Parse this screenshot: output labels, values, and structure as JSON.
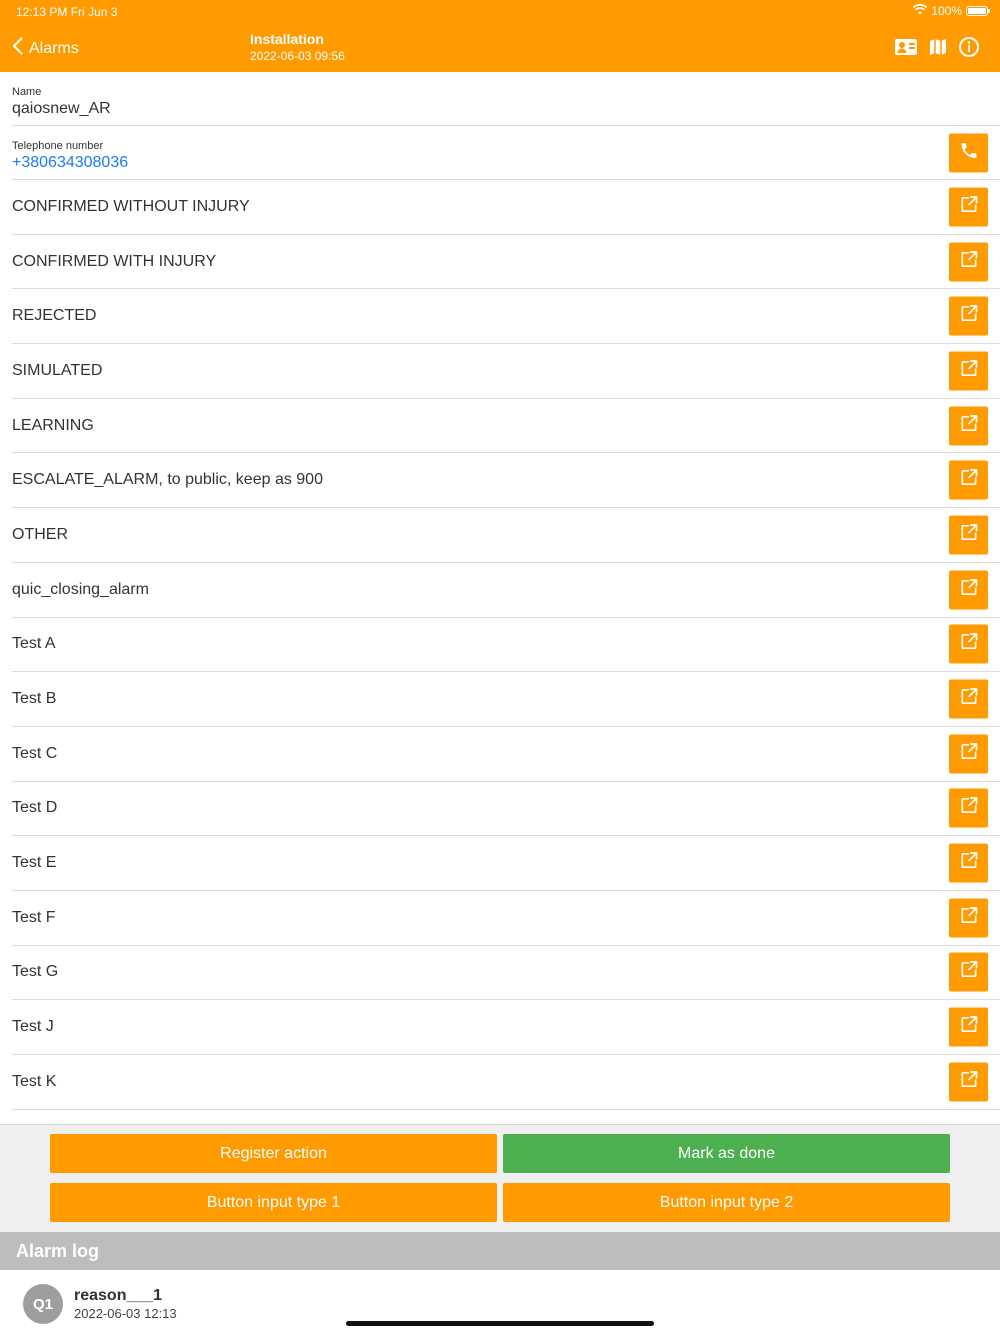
{
  "status_bar": {
    "time": "12:13 PM   Fri Jun 3",
    "battery": "100%"
  },
  "nav": {
    "back_label": "Alarms",
    "title": "Installation",
    "subtitle": "2022-06-03 09:56",
    "icons": [
      "contact-card-icon",
      "map-icon",
      "info-icon"
    ]
  },
  "details": [
    {
      "label": "Name",
      "value": "qaiosnew_AR"
    },
    {
      "label": "Telephone number",
      "value": "+380634308036"
    }
  ],
  "actions": [
    "CONFIRMED WITHOUT INJURY",
    "CONFIRMED WITH INJURY",
    "REJECTED",
    "SIMULATED",
    "LEARNING",
    "ESCALATE_ALARM, to public, keep as 900",
    "OTHER",
    "quic_closing_alarm",
    "Test A",
    "Test B",
    "Test C",
    "Test D",
    "Test E",
    "Test F",
    "Test G",
    "Test J",
    "Test K"
  ],
  "buttons": {
    "register_action": "Register action",
    "mark_as_done": "Mark as done",
    "input_type_1": "Button input type 1",
    "input_type_2": "Button input type 2"
  },
  "alarm_log": {
    "title": "Alarm log",
    "entries": [
      {
        "avatar": "Q1",
        "title": "reason___1",
        "time": "2022-06-03 12:13"
      }
    ]
  },
  "colors": {
    "accent": "#ff9a00",
    "success": "#4caf50",
    "link": "#1a7cf0",
    "log_header": "#bdbdbd"
  }
}
